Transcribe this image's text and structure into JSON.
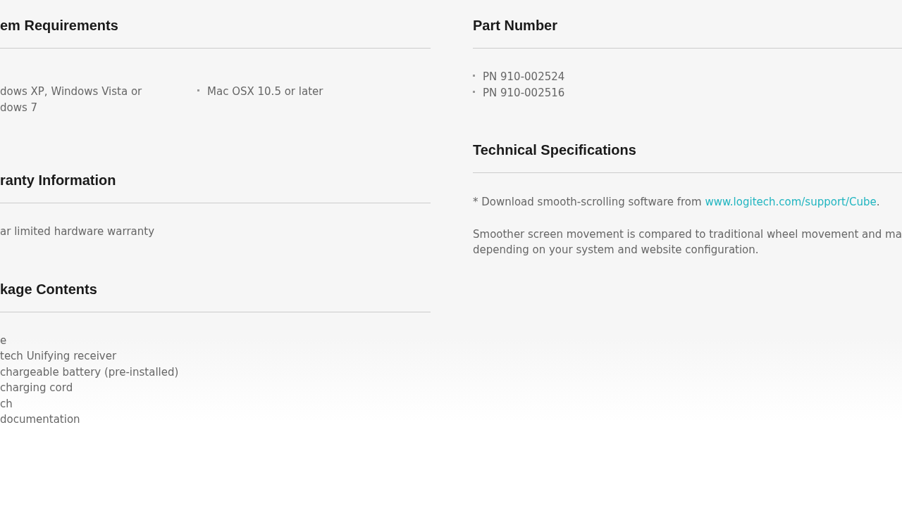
{
  "columns": [
    {
      "sections": [
        {
          "heading": "em Requirements",
          "kind": "columns",
          "items": [
            {
              "bullet": false,
              "lines": [
                "dows XP, Windows Vista or",
                "dows 7"
              ]
            },
            {
              "bullet": true,
              "lines": [
                "Mac OSX 10.5 or later"
              ]
            }
          ]
        },
        {
          "heading": "ranty Information",
          "kind": "list",
          "items": [
            {
              "bullet": false,
              "lines": [
                "ar limited hardware warranty"
              ]
            }
          ]
        },
        {
          "heading": "kage Contents",
          "kind": "list",
          "items": [
            {
              "bullet": false,
              "lines": [
                "e"
              ]
            },
            {
              "bullet": false,
              "lines": [
                "tech Unifying receiver"
              ]
            },
            {
              "bullet": false,
              "lines": [
                "chargeable battery (pre-installed)"
              ]
            },
            {
              "bullet": false,
              "lines": [
                " charging cord"
              ]
            },
            {
              "bullet": false,
              "lines": [
                "ch"
              ]
            },
            {
              "bullet": false,
              "lines": [
                " documentation"
              ]
            }
          ]
        }
      ]
    },
    {
      "sections": [
        {
          "heading": "Part Number",
          "kind": "list",
          "items": [
            {
              "bullet": true,
              "lines": [
                "PN 910-002524"
              ]
            },
            {
              "bullet": true,
              "lines": [
                "PN 910-002516"
              ]
            }
          ]
        },
        {
          "heading": "Technical Specifications",
          "kind": "text",
          "paragraphs": [
            {
              "lines": [
                "* Download smooth-scrolling software from "
              ],
              "link": "www.logitech.com/support/Cube",
              "after": "."
            },
            {
              "lines": [
                "Smoother screen movement is compared to traditional wheel movement and ma",
                "depending on your system and website configuration."
              ]
            }
          ]
        }
      ]
    }
  ]
}
